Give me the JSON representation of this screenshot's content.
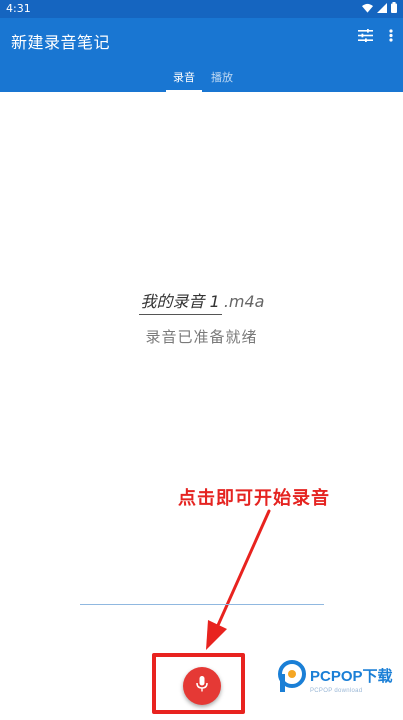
{
  "status_bar": {
    "time": "4:31"
  },
  "app_bar": {
    "title": "新建录音笔记",
    "tabs": [
      {
        "label": "录音",
        "selected": true
      },
      {
        "label": "播放",
        "selected": false
      }
    ]
  },
  "main": {
    "filename": "我的录音 1",
    "extension": ".m4a",
    "status": "录音已准备就绪"
  },
  "annotation": {
    "text": "点击即可开始录音",
    "color": "#e52421"
  },
  "watermark": {
    "brand": "PCPOP下载",
    "sub": "PCPOP download"
  },
  "colors": {
    "primary": "#1976d2",
    "status_bar": "#1565c0",
    "record": "#e53935"
  },
  "icons": [
    "wifi-icon",
    "signal-icon",
    "battery-icon",
    "tune-icon",
    "more-vert-icon",
    "mic-icon"
  ]
}
